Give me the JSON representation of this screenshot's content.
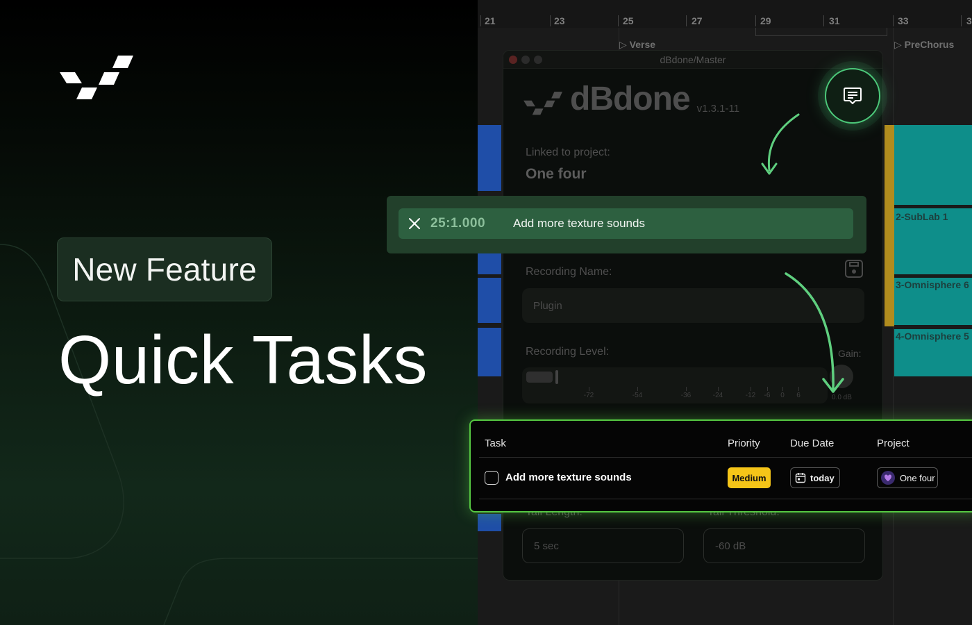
{
  "promo": {
    "badge_label": "New Feature",
    "headline": "Quick Tasks"
  },
  "daw": {
    "ruler_numbers": [
      "21",
      "23",
      "25",
      "27",
      "29",
      "31",
      "33",
      "3"
    ],
    "markers": {
      "verse": "Verse",
      "prechorus": "PreChorus"
    },
    "tracks": [
      "2-SubLab 1",
      "3-Omnisphere 6",
      "4-Omnisphere 5"
    ]
  },
  "plugin": {
    "window_title": "dBdone/Master",
    "brand_name": "dBdone",
    "version": "v1.3.1-11",
    "linked_label": "Linked to project:",
    "linked_project": "One four",
    "recording_name_label": "Recording Name:",
    "recording_name_value": "Plugin",
    "recording_level_label": "Recording Level:",
    "meter_scale": [
      "-72",
      "-54",
      "-36",
      "-24",
      "-12",
      "-6",
      "0",
      "6"
    ],
    "gain_label": "Gain:",
    "gain_value": "0.0 dB",
    "tail_length_label": "Tail Length:",
    "tail_length_value": "5 sec",
    "tail_threshold_label": "Tail Threshold:",
    "tail_threshold_value": "-60 dB"
  },
  "quick_task": {
    "timestamp": "25:1.000",
    "text": "Add more texture sounds"
  },
  "tasks_table": {
    "headers": {
      "task": "Task",
      "priority": "Priority",
      "due": "Due Date",
      "project": "Project"
    },
    "rows": [
      {
        "task": "Add more texture sounds",
        "priority": "Medium",
        "due": "today",
        "project": "One four",
        "done": false
      }
    ]
  },
  "colors": {
    "accent_green": "#4cc97a",
    "quick_task_bar": "#2d6040",
    "priority_medium": "#f5c518",
    "table_glow": "#56c842",
    "clip_blue": "#1f4ea8",
    "clip_teal": "#0e8e8a",
    "clip_gold": "#b08c1e"
  },
  "icons": {
    "logo": "dbdone-logo-icon",
    "chat": "message-list-icon",
    "close": "close-icon",
    "save": "save-disk-icon",
    "calendar": "calendar-icon",
    "project": "heart-avatar-icon"
  }
}
